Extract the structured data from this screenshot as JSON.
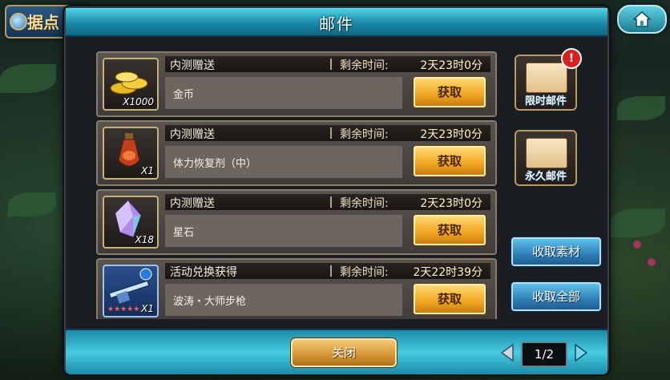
{
  "header": {
    "place_label": "据点",
    "title": "邮件"
  },
  "mails": [
    {
      "source": "内测赠送",
      "remain_label": "剩余时间:",
      "time": "2天23时0分",
      "item": "金币",
      "qty": "X1000",
      "claim": "获取",
      "kind": "coin-icon"
    },
    {
      "source": "内测赠送",
      "remain_label": "剩余时间:",
      "time": "2天23时0分",
      "item": "体力恢复剂（中）",
      "qty": "X1",
      "claim": "获取",
      "kind": "potion-icon"
    },
    {
      "source": "内测赠送",
      "remain_label": "剩余时间:",
      "time": "2天23时0分",
      "item": "星石",
      "qty": "X18",
      "claim": "获取",
      "kind": "crystal-icon"
    },
    {
      "source": "活动兑换获得",
      "remain_label": "剩余时间:",
      "time": "2天22时39分",
      "item": "波涛・大师步枪",
      "qty": "X1",
      "claim": "获取",
      "kind": "rifle-icon"
    }
  ],
  "side_tabs": {
    "limited": "限时邮件",
    "permanent": "永久邮件",
    "alert": "!"
  },
  "actions": {
    "collect_materials": "收取素材",
    "collect_all": "收取全部"
  },
  "footer": {
    "close": "关闭",
    "page": "1/2"
  },
  "colors": {
    "accent": "#2aa8c4",
    "claim": "#f0a520",
    "alert": "#d8221f"
  }
}
